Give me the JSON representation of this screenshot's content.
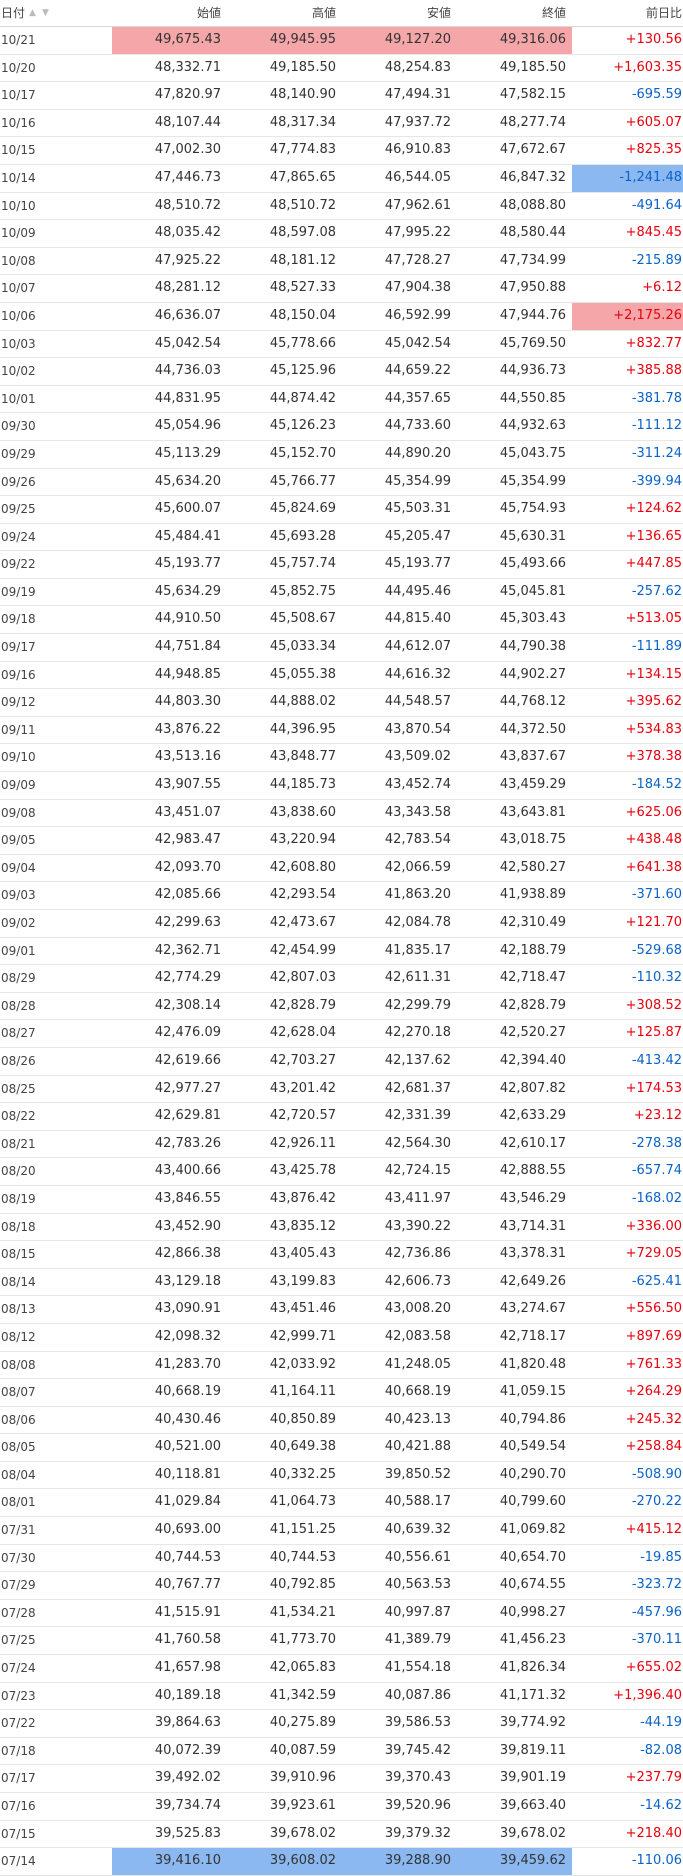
{
  "header": {
    "date": "日付",
    "open": "始値",
    "high": "高値",
    "low": "安値",
    "close": "終値",
    "change": "前日比"
  },
  "colors": {
    "up": "#e8000d",
    "down": "#0a63c9",
    "highlight_red": "#f4a6a8",
    "highlight_blue": "#8bb8f0"
  },
  "rows": [
    [
      "10/21",
      "49,675.43",
      "49,945.95",
      "49,127.20",
      "49,316.06",
      "+130.56"
    ],
    [
      "10/20",
      "48,332.71",
      "49,185.50",
      "48,254.83",
      "49,185.50",
      "+1,603.35"
    ],
    [
      "10/17",
      "47,820.97",
      "48,140.90",
      "47,494.31",
      "47,582.15",
      "-695.59"
    ],
    [
      "10/16",
      "48,107.44",
      "48,317.34",
      "47,937.72",
      "48,277.74",
      "+605.07"
    ],
    [
      "10/15",
      "47,002.30",
      "47,774.83",
      "46,910.83",
      "47,672.67",
      "+825.35"
    ],
    [
      "10/14",
      "47,446.73",
      "47,865.65",
      "46,544.05",
      "46,847.32",
      "-1,241.48"
    ],
    [
      "10/10",
      "48,510.72",
      "48,510.72",
      "47,962.61",
      "48,088.80",
      "-491.64"
    ],
    [
      "10/09",
      "48,035.42",
      "48,597.08",
      "47,995.22",
      "48,580.44",
      "+845.45"
    ],
    [
      "10/08",
      "47,925.22",
      "48,181.12",
      "47,728.27",
      "47,734.99",
      "-215.89"
    ],
    [
      "10/07",
      "48,281.12",
      "48,527.33",
      "47,904.38",
      "47,950.88",
      "+6.12"
    ],
    [
      "10/06",
      "46,636.07",
      "48,150.04",
      "46,592.99",
      "47,944.76",
      "+2,175.26"
    ],
    [
      "10/03",
      "45,042.54",
      "45,778.66",
      "45,042.54",
      "45,769.50",
      "+832.77"
    ],
    [
      "10/02",
      "44,736.03",
      "45,125.96",
      "44,659.22",
      "44,936.73",
      "+385.88"
    ],
    [
      "10/01",
      "44,831.95",
      "44,874.42",
      "44,357.65",
      "44,550.85",
      "-381.78"
    ],
    [
      "09/30",
      "45,054.96",
      "45,126.23",
      "44,733.60",
      "44,932.63",
      "-111.12"
    ],
    [
      "09/29",
      "45,113.29",
      "45,152.70",
      "44,890.20",
      "45,043.75",
      "-311.24"
    ],
    [
      "09/26",
      "45,634.20",
      "45,766.77",
      "45,354.99",
      "45,354.99",
      "-399.94"
    ],
    [
      "09/25",
      "45,600.07",
      "45,824.69",
      "45,503.31",
      "45,754.93",
      "+124.62"
    ],
    [
      "09/24",
      "45,484.41",
      "45,693.28",
      "45,205.47",
      "45,630.31",
      "+136.65"
    ],
    [
      "09/22",
      "45,193.77",
      "45,757.74",
      "45,193.77",
      "45,493.66",
      "+447.85"
    ],
    [
      "09/19",
      "45,634.29",
      "45,852.75",
      "44,495.46",
      "45,045.81",
      "-257.62"
    ],
    [
      "09/18",
      "44,910.50",
      "45,508.67",
      "44,815.40",
      "45,303.43",
      "+513.05"
    ],
    [
      "09/17",
      "44,751.84",
      "45,033.34",
      "44,612.07",
      "44,790.38",
      "-111.89"
    ],
    [
      "09/16",
      "44,948.85",
      "45,055.38",
      "44,616.32",
      "44,902.27",
      "+134.15"
    ],
    [
      "09/12",
      "44,803.30",
      "44,888.02",
      "44,548.57",
      "44,768.12",
      "+395.62"
    ],
    [
      "09/11",
      "43,876.22",
      "44,396.95",
      "43,870.54",
      "44,372.50",
      "+534.83"
    ],
    [
      "09/10",
      "43,513.16",
      "43,848.77",
      "43,509.02",
      "43,837.67",
      "+378.38"
    ],
    [
      "09/09",
      "43,907.55",
      "44,185.73",
      "43,452.74",
      "43,459.29",
      "-184.52"
    ],
    [
      "09/08",
      "43,451.07",
      "43,838.60",
      "43,343.58",
      "43,643.81",
      "+625.06"
    ],
    [
      "09/05",
      "42,983.47",
      "43,220.94",
      "42,783.54",
      "43,018.75",
      "+438.48"
    ],
    [
      "09/04",
      "42,093.70",
      "42,608.80",
      "42,066.59",
      "42,580.27",
      "+641.38"
    ],
    [
      "09/03",
      "42,085.66",
      "42,293.54",
      "41,863.20",
      "41,938.89",
      "-371.60"
    ],
    [
      "09/02",
      "42,299.63",
      "42,473.67",
      "42,084.78",
      "42,310.49",
      "+121.70"
    ],
    [
      "09/01",
      "42,362.71",
      "42,454.99",
      "41,835.17",
      "42,188.79",
      "-529.68"
    ],
    [
      "08/29",
      "42,774.29",
      "42,807.03",
      "42,611.31",
      "42,718.47",
      "-110.32"
    ],
    [
      "08/28",
      "42,308.14",
      "42,828.79",
      "42,299.79",
      "42,828.79",
      "+308.52"
    ],
    [
      "08/27",
      "42,476.09",
      "42,628.04",
      "42,270.18",
      "42,520.27",
      "+125.87"
    ],
    [
      "08/26",
      "42,619.66",
      "42,703.27",
      "42,137.62",
      "42,394.40",
      "-413.42"
    ],
    [
      "08/25",
      "42,977.27",
      "43,201.42",
      "42,681.37",
      "42,807.82",
      "+174.53"
    ],
    [
      "08/22",
      "42,629.81",
      "42,720.57",
      "42,331.39",
      "42,633.29",
      "+23.12"
    ],
    [
      "08/21",
      "42,783.26",
      "42,926.11",
      "42,564.30",
      "42,610.17",
      "-278.38"
    ],
    [
      "08/20",
      "43,400.66",
      "43,425.78",
      "42,724.15",
      "42,888.55",
      "-657.74"
    ],
    [
      "08/19",
      "43,846.55",
      "43,876.42",
      "43,411.97",
      "43,546.29",
      "-168.02"
    ],
    [
      "08/18",
      "43,452.90",
      "43,835.12",
      "43,390.22",
      "43,714.31",
      "+336.00"
    ],
    [
      "08/15",
      "42,866.38",
      "43,405.43",
      "42,736.86",
      "43,378.31",
      "+729.05"
    ],
    [
      "08/14",
      "43,129.18",
      "43,199.83",
      "42,606.73",
      "42,649.26",
      "-625.41"
    ],
    [
      "08/13",
      "43,090.91",
      "43,451.46",
      "43,008.20",
      "43,274.67",
      "+556.50"
    ],
    [
      "08/12",
      "42,098.32",
      "42,999.71",
      "42,083.58",
      "42,718.17",
      "+897.69"
    ],
    [
      "08/08",
      "41,283.70",
      "42,033.92",
      "41,248.05",
      "41,820.48",
      "+761.33"
    ],
    [
      "08/07",
      "40,668.19",
      "41,164.11",
      "40,668.19",
      "41,059.15",
      "+264.29"
    ],
    [
      "08/06",
      "40,430.46",
      "40,850.89",
      "40,423.13",
      "40,794.86",
      "+245.32"
    ],
    [
      "08/05",
      "40,521.00",
      "40,649.38",
      "40,421.88",
      "40,549.54",
      "+258.84"
    ],
    [
      "08/04",
      "40,118.81",
      "40,332.25",
      "39,850.52",
      "40,290.70",
      "-508.90"
    ],
    [
      "08/01",
      "41,029.84",
      "41,064.73",
      "40,588.17",
      "40,799.60",
      "-270.22"
    ],
    [
      "07/31",
      "40,693.00",
      "41,151.25",
      "40,639.32",
      "41,069.82",
      "+415.12"
    ],
    [
      "07/30",
      "40,744.53",
      "40,744.53",
      "40,556.61",
      "40,654.70",
      "-19.85"
    ],
    [
      "07/29",
      "40,767.77",
      "40,792.85",
      "40,563.53",
      "40,674.55",
      "-323.72"
    ],
    [
      "07/28",
      "41,515.91",
      "41,534.21",
      "40,997.87",
      "40,998.27",
      "-457.96"
    ],
    [
      "07/25",
      "41,760.58",
      "41,773.70",
      "41,389.79",
      "41,456.23",
      "-370.11"
    ],
    [
      "07/24",
      "41,657.98",
      "42,065.83",
      "41,554.18",
      "41,826.34",
      "+655.02"
    ],
    [
      "07/23",
      "40,189.18",
      "41,342.59",
      "40,087.86",
      "41,171.32",
      "+1,396.40"
    ],
    [
      "07/22",
      "39,864.63",
      "40,275.89",
      "39,586.53",
      "39,774.92",
      "-44.19"
    ],
    [
      "07/18",
      "40,072.39",
      "40,087.59",
      "39,745.42",
      "39,819.11",
      "-82.08"
    ],
    [
      "07/17",
      "39,492.02",
      "39,910.96",
      "39,370.43",
      "39,901.19",
      "+237.79"
    ],
    [
      "07/16",
      "39,734.74",
      "39,923.61",
      "39,520.96",
      "39,663.40",
      "-14.62"
    ],
    [
      "07/15",
      "39,525.83",
      "39,678.02",
      "39,379.32",
      "39,678.02",
      "+218.40"
    ],
    [
      "07/14",
      "39,416.10",
      "39,608.02",
      "39,288.90",
      "39,459.62",
      "-110.06"
    ]
  ],
  "highlights": {
    "max_row": 0,
    "min_row": 66,
    "max_change_row": 10,
    "min_change_row": 5
  }
}
